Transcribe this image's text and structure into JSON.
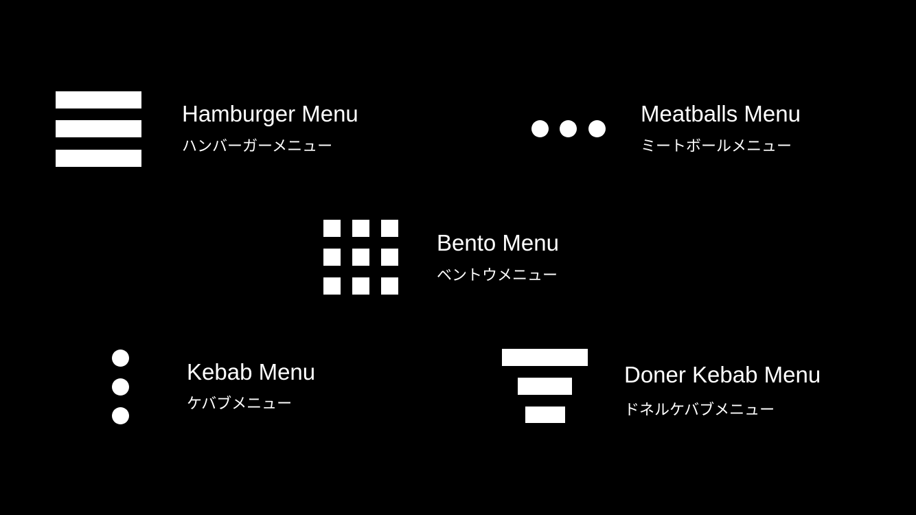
{
  "colors": {
    "background": "#000000",
    "foreground": "#ffffff"
  },
  "items": {
    "hamburger": {
      "icon": "hamburger-icon",
      "title": "Hamburger Menu",
      "subtitle": "ハンバーガーメニュー"
    },
    "meatballs": {
      "icon": "meatballs-icon",
      "title": "Meatballs Menu",
      "subtitle": "ミートボールメニュー"
    },
    "bento": {
      "icon": "bento-icon",
      "title": "Bento Menu",
      "subtitle": "ベントウメニュー"
    },
    "kebab": {
      "icon": "kebab-icon",
      "title": "Kebab Menu",
      "subtitle": "ケバブメニュー"
    },
    "doner": {
      "icon": "doner-kebab-icon",
      "title": "Doner Kebab Menu",
      "subtitle": "ドネルケバブメニュー"
    }
  }
}
